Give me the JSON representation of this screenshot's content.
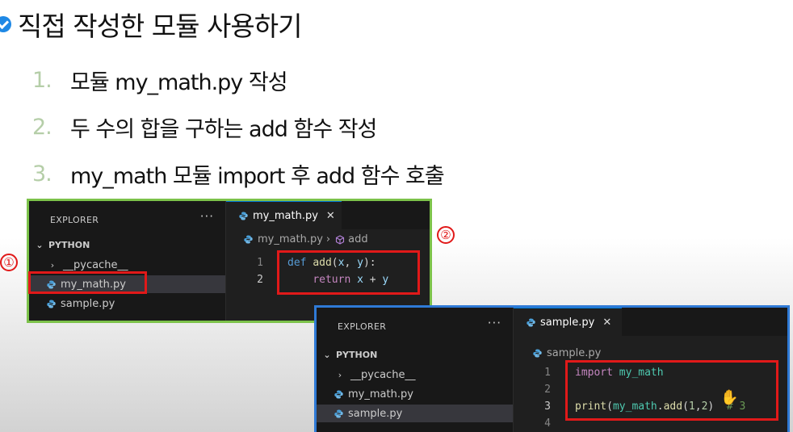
{
  "slide": {
    "title": "직접 작성한 모듈 사용하기",
    "steps": [
      {
        "num": "1.",
        "text": "모듈 my_math.py 작성"
      },
      {
        "num": "2.",
        "text": "두 수의 합을 구하는 add 함수 작성"
      },
      {
        "num": "3.",
        "text": "my_math 모듈 import 후 add 함수 호출"
      }
    ],
    "markers": {
      "one": "①",
      "two": "②"
    },
    "colors": {
      "green_border": "#7cc24a",
      "blue_border": "#2f7ad6",
      "red_box": "#e11919",
      "check": "#1e88e5"
    }
  },
  "window1": {
    "explorer_label": "EXPLORER",
    "dots": "···",
    "folder": "PYTHON",
    "tree": [
      "__pycache__",
      "my_math.py",
      "sample.py"
    ],
    "tab_label": "my_math.py",
    "tab_close": "✕",
    "breadcrumb_file": "my_math.py",
    "breadcrumb_symbol": "add",
    "lines": [
      {
        "n": "1",
        "tokens": [
          [
            "def",
            "kw"
          ],
          [
            " ",
            ""
          ],
          [
            "add",
            "fn"
          ],
          [
            "(",
            ""
          ],
          [
            "x",
            "pm"
          ],
          [
            ", ",
            ""
          ],
          [
            "y",
            "pm"
          ],
          [
            "):",
            ""
          ]
        ]
      },
      {
        "n": "2",
        "tokens": [
          [
            "    ",
            ""
          ],
          [
            "return",
            "kw2"
          ],
          [
            " ",
            ""
          ],
          [
            "x",
            "pm"
          ],
          [
            " + ",
            ""
          ],
          [
            "y",
            "pm"
          ]
        ]
      }
    ]
  },
  "window2": {
    "explorer_label": "EXPLORER",
    "dots": "···",
    "folder": "PYTHON",
    "tree": [
      "__pycache__",
      "my_math.py",
      "sample.py"
    ],
    "tab_label": "sample.py",
    "tab_close": "✕",
    "breadcrumb_file": "sample.py",
    "lines": [
      {
        "n": "1",
        "tokens": [
          [
            "import",
            "kw2"
          ],
          [
            " ",
            ""
          ],
          [
            "my_math",
            "mod"
          ]
        ]
      },
      {
        "n": "2",
        "tokens": []
      },
      {
        "n": "3",
        "tokens": [
          [
            "print",
            "fn"
          ],
          [
            "(",
            ""
          ],
          [
            "my_math",
            "mod"
          ],
          [
            ".",
            ""
          ],
          [
            "add",
            "fn"
          ],
          [
            "(",
            ""
          ],
          [
            "1",
            "num"
          ],
          [
            ",",
            ""
          ],
          [
            "2",
            "num"
          ],
          [
            ")",
            ""
          ],
          [
            "  ",
            ""
          ],
          [
            "# 3",
            "cm"
          ]
        ]
      },
      {
        "n": "4",
        "tokens": []
      }
    ]
  }
}
